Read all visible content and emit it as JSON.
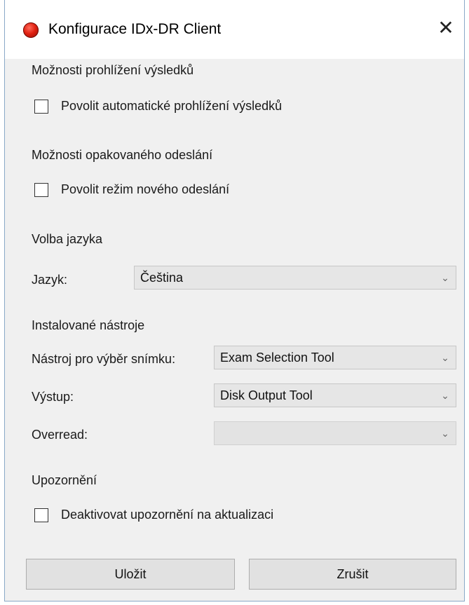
{
  "window": {
    "title": "Konfigurace IDx-DR Client",
    "close_glyph": "✕",
    "icon": "app-logo-red-circle"
  },
  "results_view": {
    "section_label": "Možnosti prohlížení výsledků",
    "checkbox_label": "Povolit automatické prohlížení výsledků",
    "checked": false
  },
  "resend": {
    "section_label": "Možnosti opakovaného odeslání",
    "checkbox_label": "Povolit režim nového odeslání",
    "checked": false
  },
  "language": {
    "section_label": "Volba jazyka",
    "field_label": "Jazyk:",
    "selected": "Čeština"
  },
  "tools": {
    "section_label": "Instalované nástroje",
    "image_selection_label": "Nástroj pro výběr snímku:",
    "image_selection_value": "Exam Selection Tool",
    "output_label": "Výstup:",
    "output_value": "Disk Output Tool",
    "overread_label": "Overread:",
    "overread_value": ""
  },
  "notifications": {
    "section_label": "Upozornění",
    "checkbox_label": "Deaktivovat upozornění na aktualizaci",
    "checked": false
  },
  "buttons": {
    "save": "Uložit",
    "cancel": "Zrušit"
  },
  "icons": {
    "dropdown_arrow": "chevron-down-icon",
    "close": "close-icon"
  }
}
